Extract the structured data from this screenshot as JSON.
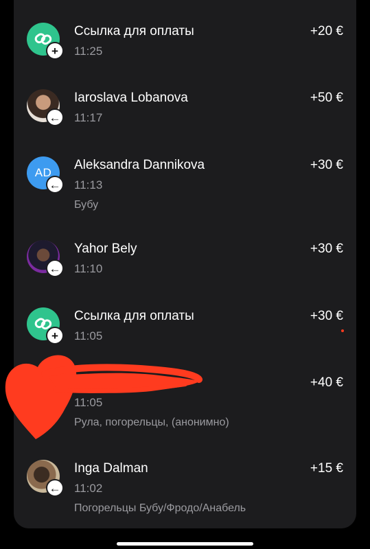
{
  "transactions": [
    {
      "avatar_type": "link",
      "avatar_icon": "link-icon",
      "badge_icon": "plus-icon",
      "name": "Ссылка для оплаты",
      "time": "11:25",
      "note": "",
      "amount": "+20 €"
    },
    {
      "avatar_type": "photo",
      "badge_icon": "arrow-left-icon",
      "name": "Iaroslava Lobanova",
      "time": "11:17",
      "note": "",
      "amount": "+50 €"
    },
    {
      "avatar_type": "initials",
      "initials": "AD",
      "badge_icon": "arrow-left-icon",
      "name": "Aleksandra Dannikova",
      "time": "11:13",
      "note": "Бубу",
      "amount": "+30 €"
    },
    {
      "avatar_type": "photo",
      "badge_icon": "arrow-left-icon",
      "name": "Yahor Bely",
      "time": "11:10",
      "note": "",
      "amount": "+30 €"
    },
    {
      "avatar_type": "link",
      "avatar_icon": "link-icon",
      "badge_icon": "plus-icon",
      "name": "Ссылка для оплаты",
      "time": "11:05",
      "note": "",
      "amount": "+30 €"
    },
    {
      "avatar_type": "redacted",
      "badge_icon": "",
      "name": "",
      "time": "11:05",
      "note": "Рула, погорельцы, (анонимно)",
      "amount": "+40 €"
    },
    {
      "avatar_type": "photo",
      "badge_icon": "arrow-left-icon",
      "name": "Inga Dalman",
      "time": "11:02",
      "note": "Погорельцы Бубу/Фродо/Анабель",
      "amount": "+15 €"
    }
  ],
  "colors": {
    "background": "#000000",
    "card": "#1c1c1e",
    "link_avatar": "#2fc48d",
    "initials_avatar": "#3d9bf0",
    "secondary_text": "#9b9ba0",
    "scribble": "#ff3b1f"
  }
}
